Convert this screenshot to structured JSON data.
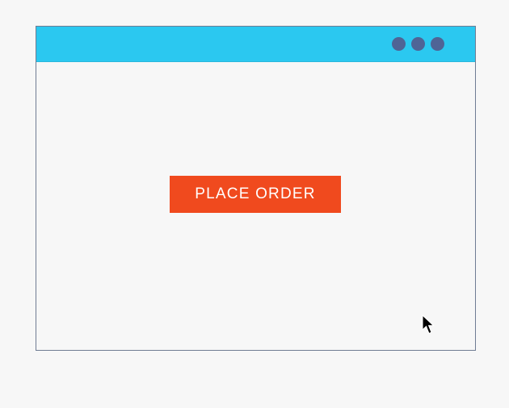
{
  "colors": {
    "page_background": "#f7f7f7",
    "titlebar": "#2bc8f0",
    "window_border": "#6f7c93",
    "window_dots": "#4f6496",
    "button_background": "#f04a1e",
    "button_text": "#ffffff"
  },
  "window": {
    "controls": [
      {
        "icon": "window-dot-icon"
      },
      {
        "icon": "window-dot-icon"
      },
      {
        "icon": "window-dot-icon"
      }
    ]
  },
  "main": {
    "button_label": "PLACE ORDER"
  },
  "pointer": {
    "icon": "mouse-pointer-icon"
  }
}
